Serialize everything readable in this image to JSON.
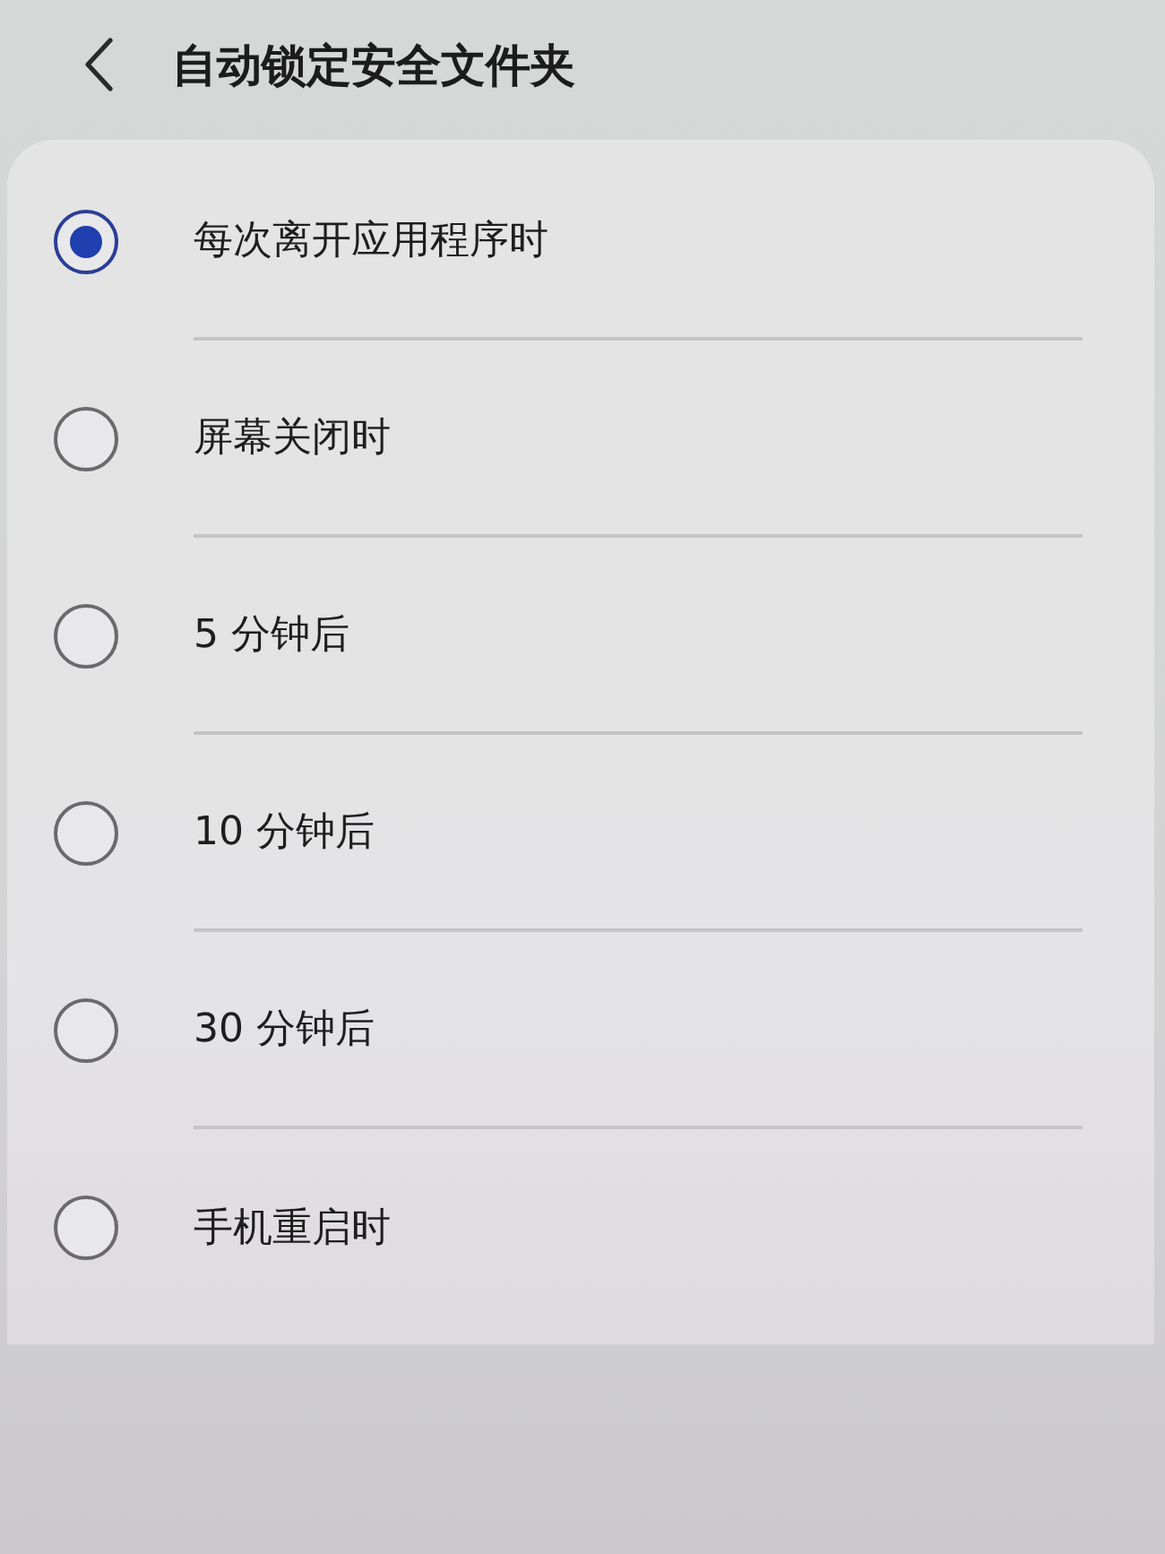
{
  "header": {
    "title": "自动锁定安全文件夹"
  },
  "options": [
    {
      "label": "每次离开应用程序时",
      "selected": true
    },
    {
      "label": "屏幕关闭时",
      "selected": false
    },
    {
      "label": "5 分钟后",
      "selected": false
    },
    {
      "label": "10 分钟后",
      "selected": false
    },
    {
      "label": "30 分钟后",
      "selected": false
    },
    {
      "label": "手机重启时",
      "selected": false
    }
  ]
}
